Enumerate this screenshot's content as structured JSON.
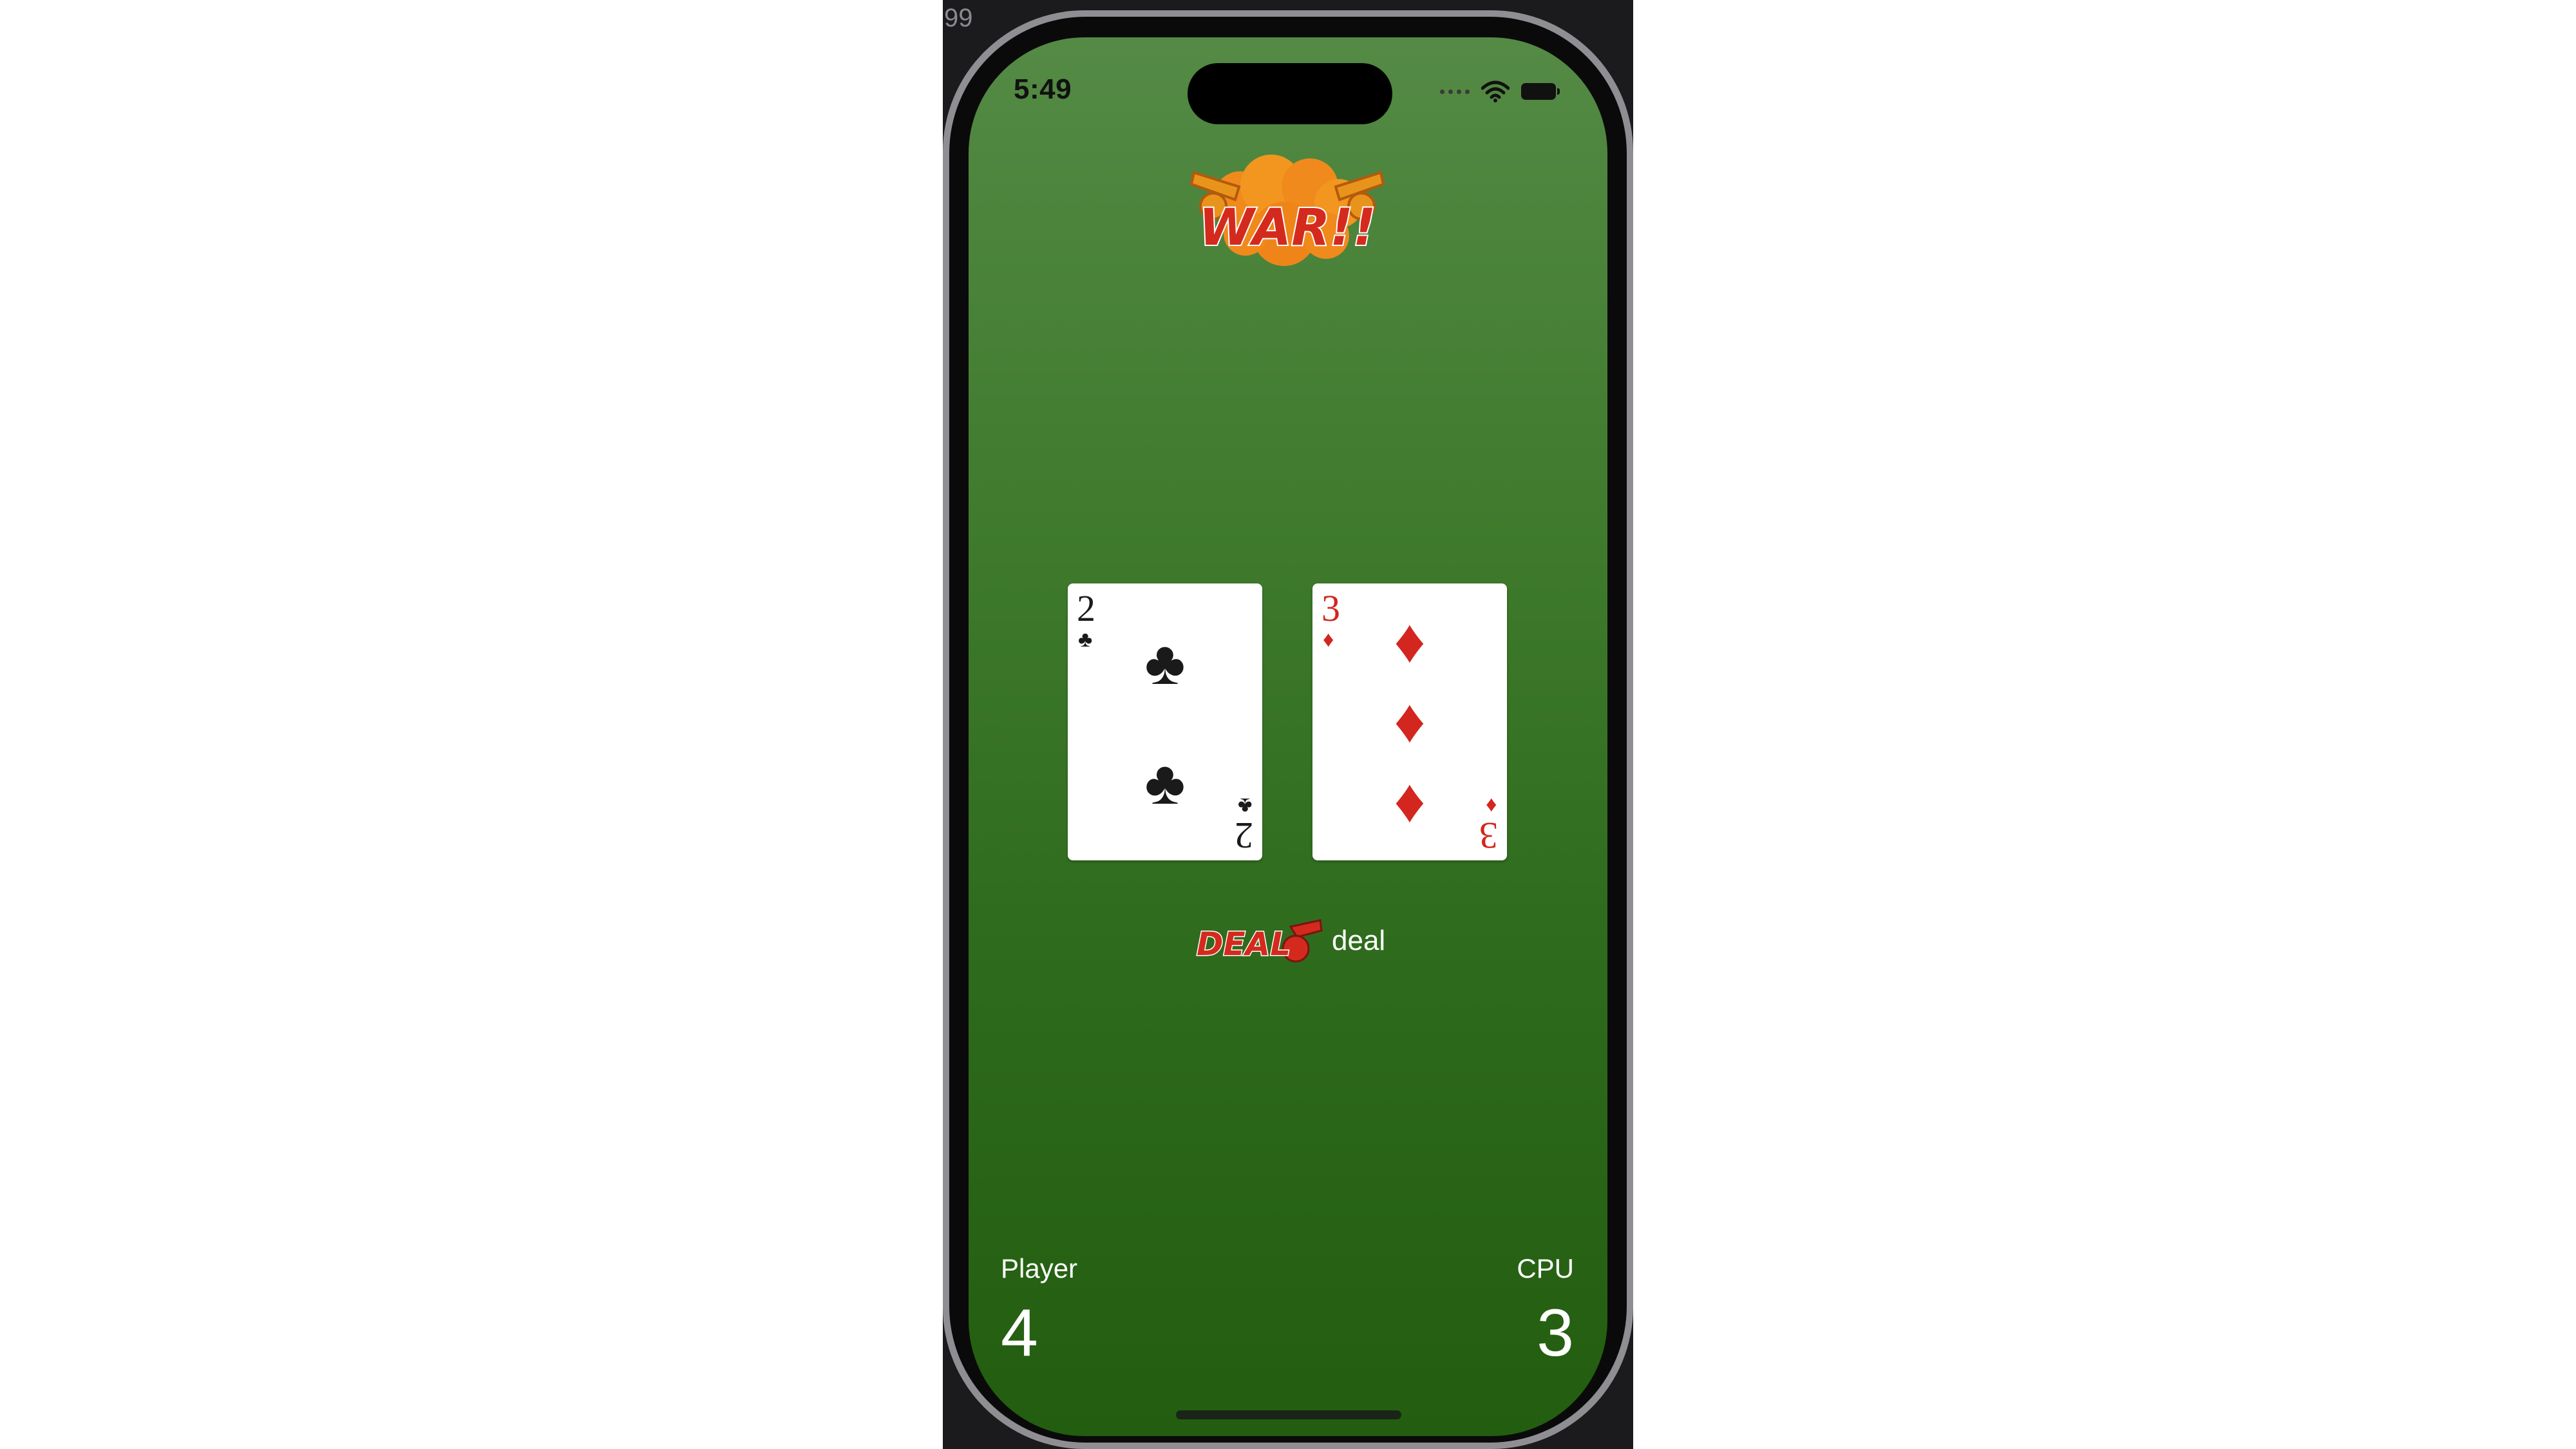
{
  "behind_window": {
    "text": "99"
  },
  "status_bar": {
    "time": "5:49"
  },
  "logo": {
    "text": "WAR!!"
  },
  "cards": {
    "player": {
      "rank": "2",
      "suit_symbol": "♣",
      "suit_name": "clubs",
      "color": "#1a1a1a"
    },
    "cpu": {
      "rank": "3",
      "suit_symbol": "♦",
      "suit_name": "diamonds",
      "color": "#d3261f"
    }
  },
  "deal_button": {
    "image_text": "DEAL",
    "label": "deal"
  },
  "scores": {
    "player": {
      "label": "Player",
      "value": "4"
    },
    "cpu": {
      "label": "CPU",
      "value": "3"
    }
  },
  "colors": {
    "felt_top": "#548a45",
    "felt_bottom": "#235d0f",
    "logo_orange": "#f08a1c",
    "logo_red": "#d42a1e"
  }
}
